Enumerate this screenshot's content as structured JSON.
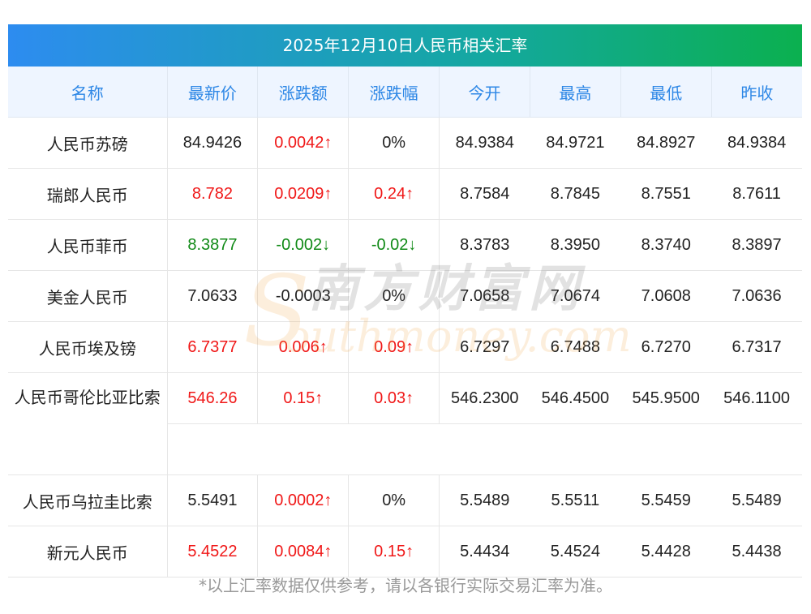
{
  "title": "2025年12月10日人民币相关汇率",
  "headers": [
    "名称",
    "最新价",
    "涨跌额",
    "涨跌幅",
    "今开",
    "最高",
    "最低",
    "昨收"
  ],
  "rows": [
    {
      "name": "人民币苏磅",
      "latest": "84.9426",
      "change": "0.0042↑",
      "pct": "0%",
      "open": "84.9384",
      "high": "84.9721",
      "low": "84.8927",
      "prev": "84.9384"
    },
    {
      "name": "瑞郎人民币",
      "latest": "8.782",
      "change": "0.0209↑",
      "pct": "0.24↑",
      "open": "8.7584",
      "high": "8.7845",
      "low": "8.7551",
      "prev": "8.7611"
    },
    {
      "name": "人民币菲币",
      "latest": "8.3877",
      "change": "-0.002↓",
      "pct": "-0.02↓",
      "open": "8.3783",
      "high": "8.3950",
      "low": "8.3740",
      "prev": "8.3897"
    },
    {
      "name": "美金人民币",
      "latest": "7.0633",
      "change": "-0.0003",
      "pct": "0%",
      "open": "7.0658",
      "high": "7.0674",
      "low": "7.0608",
      "prev": "7.0636"
    },
    {
      "name": "人民币埃及镑",
      "latest": "6.7377",
      "change": "0.006↑",
      "pct": "0.09↑",
      "open": "6.7297",
      "high": "6.7488",
      "low": "6.7270",
      "prev": "6.7317"
    },
    {
      "name": "人民币哥伦比亚比索",
      "latest": "546.26",
      "change": "0.15↑",
      "pct": "0.03↑",
      "open": "546.2300",
      "high": "546.4500",
      "low": "545.9500",
      "prev": "546.1100"
    },
    {
      "name": "人民币乌拉圭比索",
      "latest": "5.5491",
      "change": "0.0002↑",
      "pct": "0%",
      "open": "5.5489",
      "high": "5.5511",
      "low": "5.5459",
      "prev": "5.5489"
    },
    {
      "name": "新元人民币",
      "latest": "5.4522",
      "change": "0.0084↑",
      "pct": "0.15↑",
      "open": "5.4434",
      "high": "5.4524",
      "low": "5.4428",
      "prev": "5.4438"
    }
  ],
  "note": "*以上汇率数据仅供参考，请以各银行实际交易汇率为准。",
  "watermark": {
    "cn": "南方财富网",
    "en": "outhmoney.com",
    "letter": "S"
  },
  "colors": {
    "up": "#f01818",
    "down": "#118a17",
    "header_text": "#2d87e6"
  }
}
